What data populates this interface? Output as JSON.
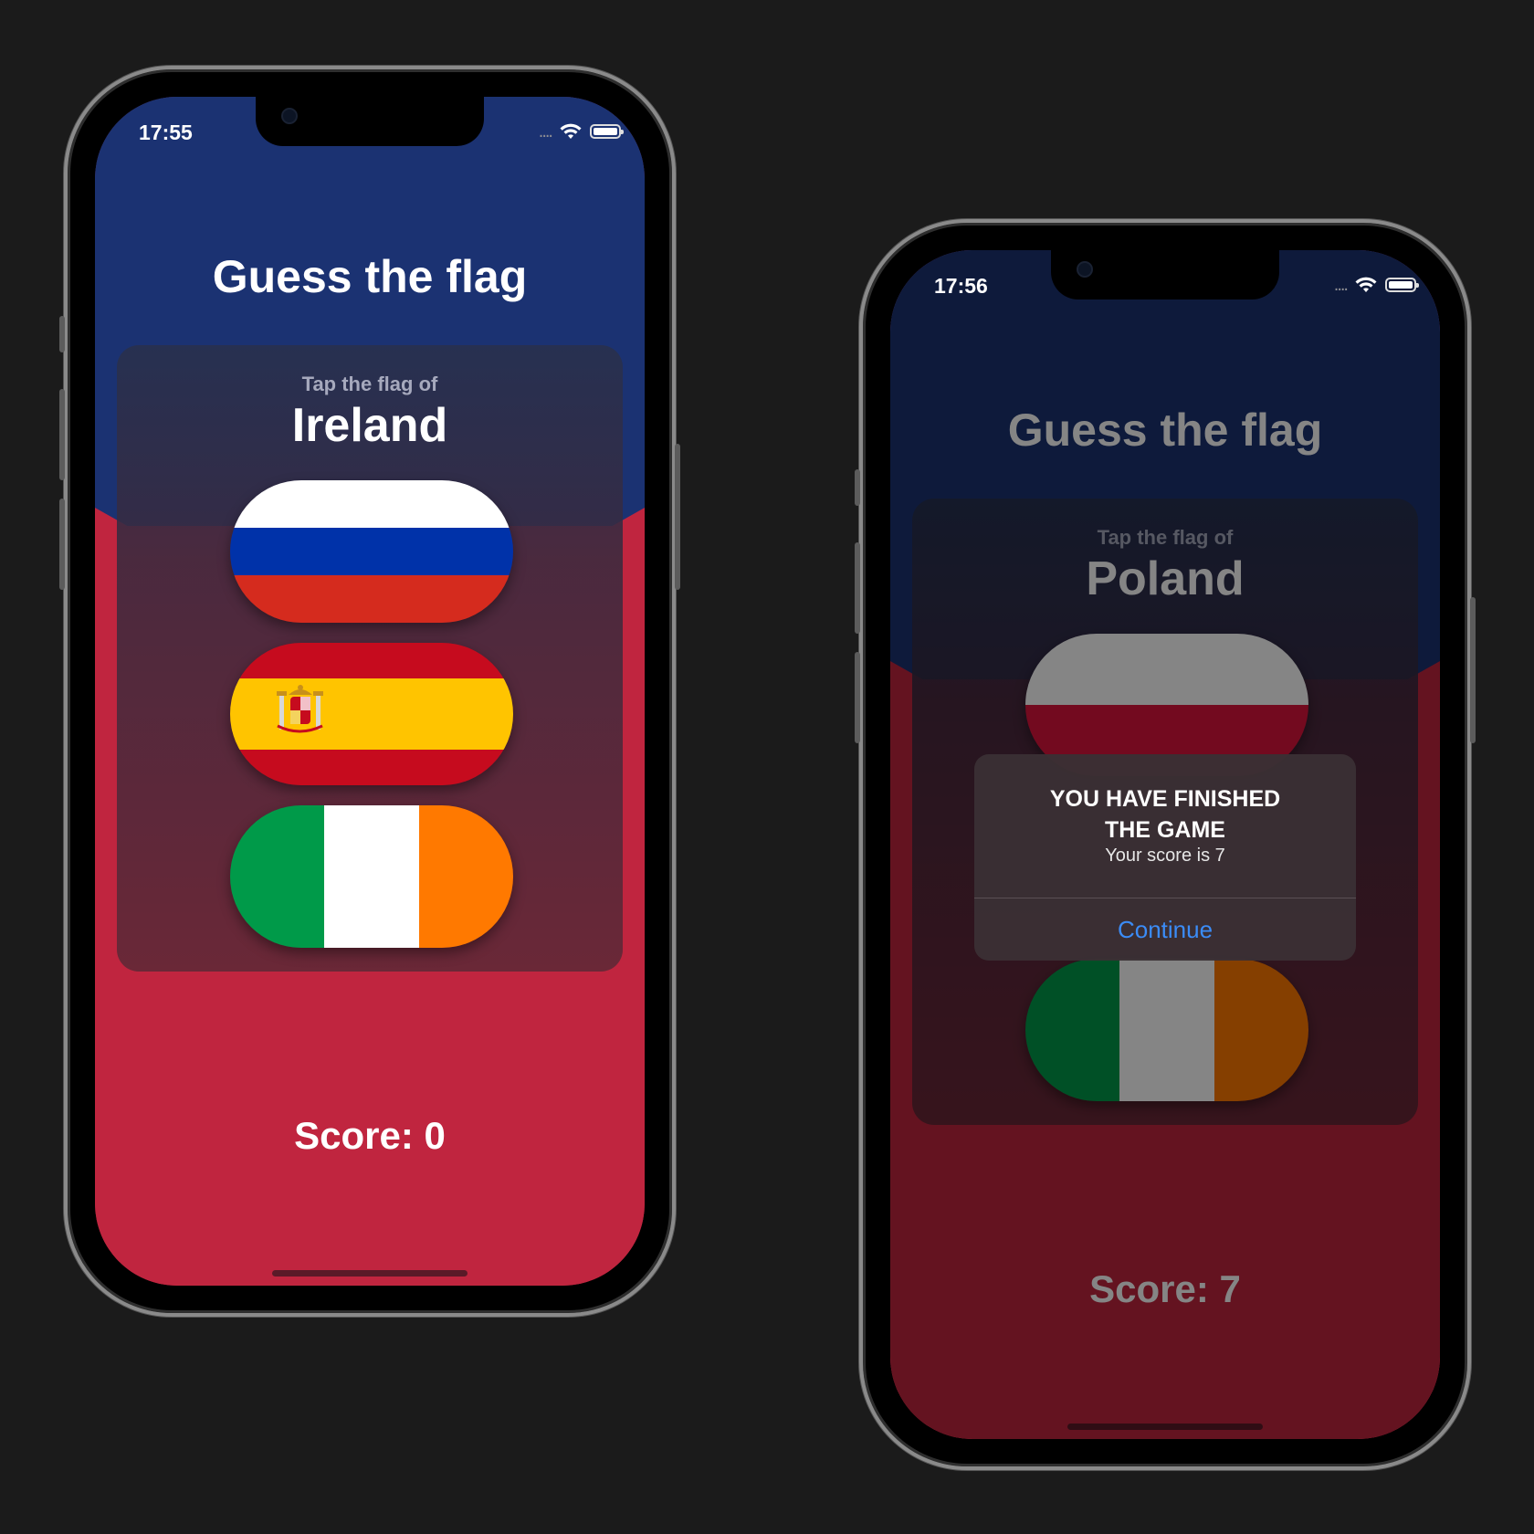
{
  "colors": {
    "background": "#1b1b1b",
    "blue": "#1b3272",
    "red": "#c0253f",
    "alert_button": "#3b8cf7"
  },
  "screens": [
    {
      "status": {
        "time": "17:55"
      },
      "title": "Guess the flag",
      "prompt": "Tap the flag of",
      "country": "Ireland",
      "flags": [
        {
          "name": "Russia",
          "icon": "russia-flag"
        },
        {
          "name": "Spain",
          "icon": "spain-flag"
        },
        {
          "name": "Ireland",
          "icon": "ireland-flag"
        }
      ],
      "score": "Score: 0"
    },
    {
      "status": {
        "time": "17:56"
      },
      "title": "Guess the flag",
      "prompt": "Tap the flag of",
      "country": "Poland",
      "flags": [
        {
          "name": "Poland",
          "icon": "poland-flag"
        },
        {
          "name": "Ireland",
          "icon": "ireland-flag"
        }
      ],
      "score": "Score: 7",
      "alert": {
        "title": "YOU HAVE FINISHED THE GAME",
        "message": "Your score is 7",
        "button": "Continue"
      }
    }
  ]
}
